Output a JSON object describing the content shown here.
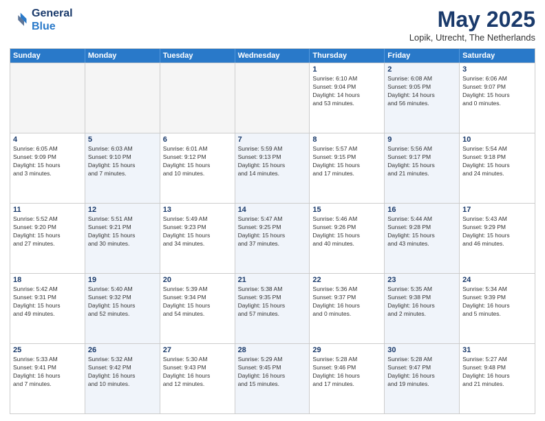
{
  "header": {
    "logo_line1": "General",
    "logo_line2": "Blue",
    "month_title": "May 2025",
    "location": "Lopik, Utrecht, The Netherlands"
  },
  "days_of_week": [
    "Sunday",
    "Monday",
    "Tuesday",
    "Wednesday",
    "Thursday",
    "Friday",
    "Saturday"
  ],
  "weeks": [
    [
      {
        "day": "",
        "empty": true
      },
      {
        "day": "",
        "empty": true
      },
      {
        "day": "",
        "empty": true
      },
      {
        "day": "",
        "empty": true
      },
      {
        "day": "1",
        "shade": false,
        "lines": [
          "Sunrise: 6:10 AM",
          "Sunset: 9:04 PM",
          "Daylight: 14 hours",
          "and 53 minutes."
        ]
      },
      {
        "day": "2",
        "shade": true,
        "lines": [
          "Sunrise: 6:08 AM",
          "Sunset: 9:05 PM",
          "Daylight: 14 hours",
          "and 56 minutes."
        ]
      },
      {
        "day": "3",
        "shade": false,
        "lines": [
          "Sunrise: 6:06 AM",
          "Sunset: 9:07 PM",
          "Daylight: 15 hours",
          "and 0 minutes."
        ]
      }
    ],
    [
      {
        "day": "4",
        "shade": false,
        "lines": [
          "Sunrise: 6:05 AM",
          "Sunset: 9:09 PM",
          "Daylight: 15 hours",
          "and 3 minutes."
        ]
      },
      {
        "day": "5",
        "shade": true,
        "lines": [
          "Sunrise: 6:03 AM",
          "Sunset: 9:10 PM",
          "Daylight: 15 hours",
          "and 7 minutes."
        ]
      },
      {
        "day": "6",
        "shade": false,
        "lines": [
          "Sunrise: 6:01 AM",
          "Sunset: 9:12 PM",
          "Daylight: 15 hours",
          "and 10 minutes."
        ]
      },
      {
        "day": "7",
        "shade": true,
        "lines": [
          "Sunrise: 5:59 AM",
          "Sunset: 9:13 PM",
          "Daylight: 15 hours",
          "and 14 minutes."
        ]
      },
      {
        "day": "8",
        "shade": false,
        "lines": [
          "Sunrise: 5:57 AM",
          "Sunset: 9:15 PM",
          "Daylight: 15 hours",
          "and 17 minutes."
        ]
      },
      {
        "day": "9",
        "shade": true,
        "lines": [
          "Sunrise: 5:56 AM",
          "Sunset: 9:17 PM",
          "Daylight: 15 hours",
          "and 21 minutes."
        ]
      },
      {
        "day": "10",
        "shade": false,
        "lines": [
          "Sunrise: 5:54 AM",
          "Sunset: 9:18 PM",
          "Daylight: 15 hours",
          "and 24 minutes."
        ]
      }
    ],
    [
      {
        "day": "11",
        "shade": false,
        "lines": [
          "Sunrise: 5:52 AM",
          "Sunset: 9:20 PM",
          "Daylight: 15 hours",
          "and 27 minutes."
        ]
      },
      {
        "day": "12",
        "shade": true,
        "lines": [
          "Sunrise: 5:51 AM",
          "Sunset: 9:21 PM",
          "Daylight: 15 hours",
          "and 30 minutes."
        ]
      },
      {
        "day": "13",
        "shade": false,
        "lines": [
          "Sunrise: 5:49 AM",
          "Sunset: 9:23 PM",
          "Daylight: 15 hours",
          "and 34 minutes."
        ]
      },
      {
        "day": "14",
        "shade": true,
        "lines": [
          "Sunrise: 5:47 AM",
          "Sunset: 9:25 PM",
          "Daylight: 15 hours",
          "and 37 minutes."
        ]
      },
      {
        "day": "15",
        "shade": false,
        "lines": [
          "Sunrise: 5:46 AM",
          "Sunset: 9:26 PM",
          "Daylight: 15 hours",
          "and 40 minutes."
        ]
      },
      {
        "day": "16",
        "shade": true,
        "lines": [
          "Sunrise: 5:44 AM",
          "Sunset: 9:28 PM",
          "Daylight: 15 hours",
          "and 43 minutes."
        ]
      },
      {
        "day": "17",
        "shade": false,
        "lines": [
          "Sunrise: 5:43 AM",
          "Sunset: 9:29 PM",
          "Daylight: 15 hours",
          "and 46 minutes."
        ]
      }
    ],
    [
      {
        "day": "18",
        "shade": false,
        "lines": [
          "Sunrise: 5:42 AM",
          "Sunset: 9:31 PM",
          "Daylight: 15 hours",
          "and 49 minutes."
        ]
      },
      {
        "day": "19",
        "shade": true,
        "lines": [
          "Sunrise: 5:40 AM",
          "Sunset: 9:32 PM",
          "Daylight: 15 hours",
          "and 52 minutes."
        ]
      },
      {
        "day": "20",
        "shade": false,
        "lines": [
          "Sunrise: 5:39 AM",
          "Sunset: 9:34 PM",
          "Daylight: 15 hours",
          "and 54 minutes."
        ]
      },
      {
        "day": "21",
        "shade": true,
        "lines": [
          "Sunrise: 5:38 AM",
          "Sunset: 9:35 PM",
          "Daylight: 15 hours",
          "and 57 minutes."
        ]
      },
      {
        "day": "22",
        "shade": false,
        "lines": [
          "Sunrise: 5:36 AM",
          "Sunset: 9:37 PM",
          "Daylight: 16 hours",
          "and 0 minutes."
        ]
      },
      {
        "day": "23",
        "shade": true,
        "lines": [
          "Sunrise: 5:35 AM",
          "Sunset: 9:38 PM",
          "Daylight: 16 hours",
          "and 2 minutes."
        ]
      },
      {
        "day": "24",
        "shade": false,
        "lines": [
          "Sunrise: 5:34 AM",
          "Sunset: 9:39 PM",
          "Daylight: 16 hours",
          "and 5 minutes."
        ]
      }
    ],
    [
      {
        "day": "25",
        "shade": false,
        "lines": [
          "Sunrise: 5:33 AM",
          "Sunset: 9:41 PM",
          "Daylight: 16 hours",
          "and 7 minutes."
        ]
      },
      {
        "day": "26",
        "shade": true,
        "lines": [
          "Sunrise: 5:32 AM",
          "Sunset: 9:42 PM",
          "Daylight: 16 hours",
          "and 10 minutes."
        ]
      },
      {
        "day": "27",
        "shade": false,
        "lines": [
          "Sunrise: 5:30 AM",
          "Sunset: 9:43 PM",
          "Daylight: 16 hours",
          "and 12 minutes."
        ]
      },
      {
        "day": "28",
        "shade": true,
        "lines": [
          "Sunrise: 5:29 AM",
          "Sunset: 9:45 PM",
          "Daylight: 16 hours",
          "and 15 minutes."
        ]
      },
      {
        "day": "29",
        "shade": false,
        "lines": [
          "Sunrise: 5:28 AM",
          "Sunset: 9:46 PM",
          "Daylight: 16 hours",
          "and 17 minutes."
        ]
      },
      {
        "day": "30",
        "shade": true,
        "lines": [
          "Sunrise: 5:28 AM",
          "Sunset: 9:47 PM",
          "Daylight: 16 hours",
          "and 19 minutes."
        ]
      },
      {
        "day": "31",
        "shade": false,
        "lines": [
          "Sunrise: 5:27 AM",
          "Sunset: 9:48 PM",
          "Daylight: 16 hours",
          "and 21 minutes."
        ]
      }
    ]
  ]
}
